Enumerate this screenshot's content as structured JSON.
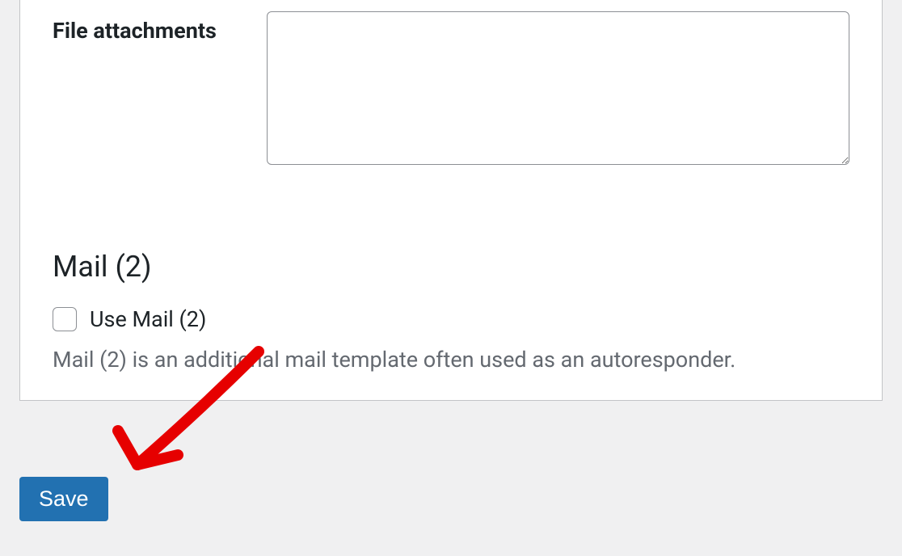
{
  "form": {
    "file_attachments": {
      "label": "File attachments",
      "value": ""
    }
  },
  "mail2": {
    "heading": "Mail (2)",
    "checkbox_label": "Use Mail (2)",
    "checkbox_checked": false,
    "description": "Mail (2) is an additional mail template often used as an autoresponder."
  },
  "actions": {
    "save_label": "Save"
  },
  "annotation": {
    "arrow_color": "#e60000"
  }
}
